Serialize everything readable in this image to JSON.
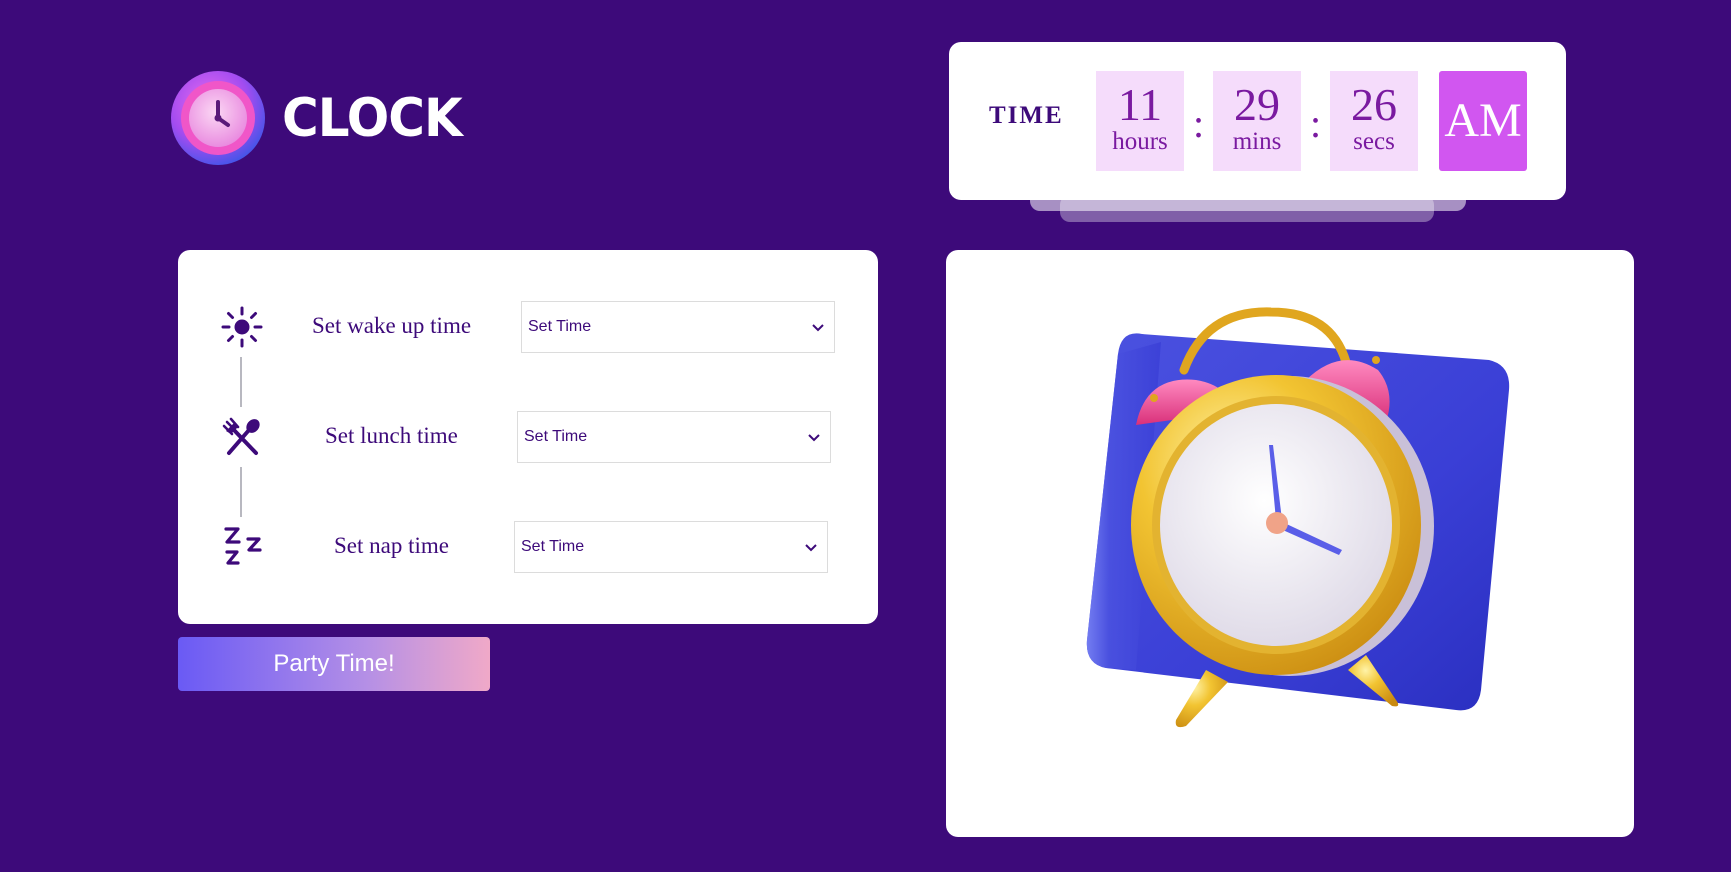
{
  "logo": {
    "text": "CLOCK",
    "icon": "clock-icon"
  },
  "time_display": {
    "label": "TIME",
    "hours": {
      "value": "11",
      "unit": "hours"
    },
    "minutes": {
      "value": "29",
      "unit": "mins"
    },
    "seconds": {
      "value": "26",
      "unit": "secs"
    },
    "separator": ":",
    "meridiem": "AM"
  },
  "schedule": {
    "items": [
      {
        "icon": "sun-icon",
        "label": "Set wake up time",
        "select_value": "Set Time"
      },
      {
        "icon": "utensils-icon",
        "label": "Set lunch time",
        "select_value": "Set Time"
      },
      {
        "icon": "sleep-zzz-icon",
        "label": "Set nap time",
        "select_value": "Set Time"
      }
    ]
  },
  "party_button": {
    "label": "Party Time!"
  },
  "illustration": {
    "icon": "alarm-clock-illustration"
  },
  "colors": {
    "background": "#3d0a7a",
    "accent": "#d156f0",
    "time_box": "#f5dcfb",
    "text_primary": "#3d0a7a"
  }
}
